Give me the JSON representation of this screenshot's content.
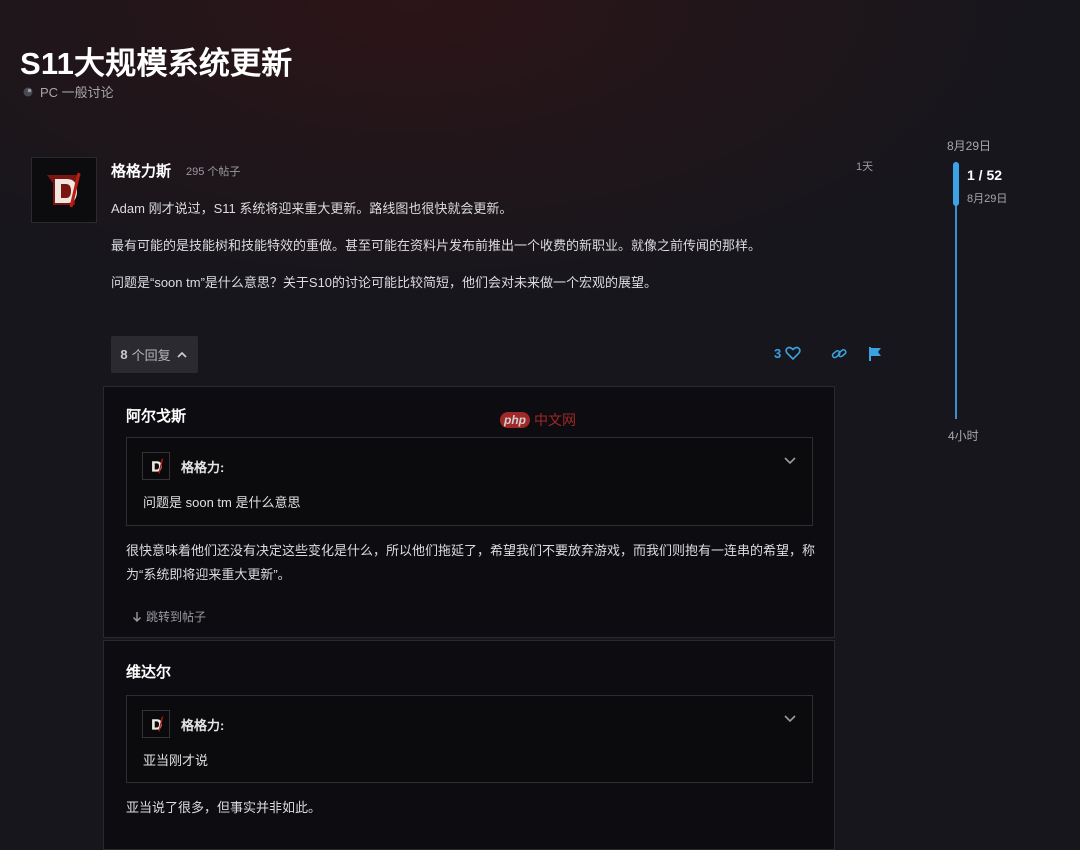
{
  "topic": {
    "title": "S11大规模系统更新",
    "category": "PC 一般讨论"
  },
  "post": {
    "author": "格格力斯",
    "post_count": "295 个帖子",
    "time": "1天",
    "paragraphs": [
      "Adam 刚才说过，S11 系统将迎来重大更新。路线图也很快就会更新。",
      "最有可能的是技能树和技能特效的重做。甚至可能在资料片发布前推出一个收费的新职业。就像之前传闻的那样。",
      "问题是“soon tm”是什么意思？关于S10的讨论可能比较简短，他们会对未来做一个宏观的展望。"
    ],
    "replies_count": "8",
    "replies_label": "个回复",
    "likes": "3"
  },
  "replies": [
    {
      "author": "阿尔戈斯",
      "quote_author": "格格力:",
      "quote_text": "问题是 soon tm 是什么意思",
      "text": "很快意味着他们还没有决定这些变化是什么，所以他们拖延了，希望我们不要放弃游戏，而我们则抱有一连串的希望，称为“系统即将迎来重大更新”。",
      "jump_label": "跳转到帖子"
    },
    {
      "author": "维达尔",
      "quote_author": "格格力:",
      "quote_text": "亚当刚才说",
      "text": "亚当说了很多，但事实并非如此。"
    }
  ],
  "timeline": {
    "top_date": "8月29日",
    "position": "1 / 52",
    "position_date": "8月29日",
    "bottom_label": "4小时"
  },
  "watermark": {
    "badge": "php",
    "text": "中文网"
  },
  "colors": {
    "accent": "#3aa0de",
    "background": "#17161c",
    "brand_red": "#c7302e"
  }
}
